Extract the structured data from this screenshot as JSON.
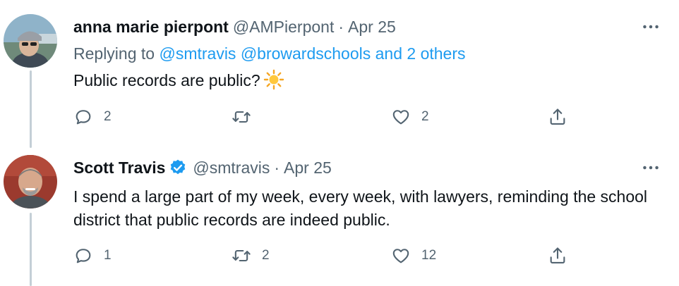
{
  "tweets": [
    {
      "name": "anna marie pierpont",
      "handle": "@AMPierpont",
      "separator": "·",
      "date": "Apr 25",
      "verified": false,
      "replying_prefix": "Replying to",
      "replying_to": "@smtravis @browardschools and 2 others",
      "text": "Public records are public?",
      "emoji": "sun-icon",
      "reply_count": "2",
      "retweet_count": "",
      "like_count": "2"
    },
    {
      "name": "Scott Travis",
      "handle": "@smtravis",
      "separator": "·",
      "date": "Apr 25",
      "verified": true,
      "text": "I spend a large part of my week, every week, with lawyers, reminding the school district that public records are indeed public.",
      "reply_count": "1",
      "retweet_count": "2",
      "like_count": "12"
    }
  ],
  "colors": {
    "accent": "#1d9bf0",
    "text": "#0f1419",
    "secondary": "#536471",
    "thread_line": "#c4cfd6"
  }
}
